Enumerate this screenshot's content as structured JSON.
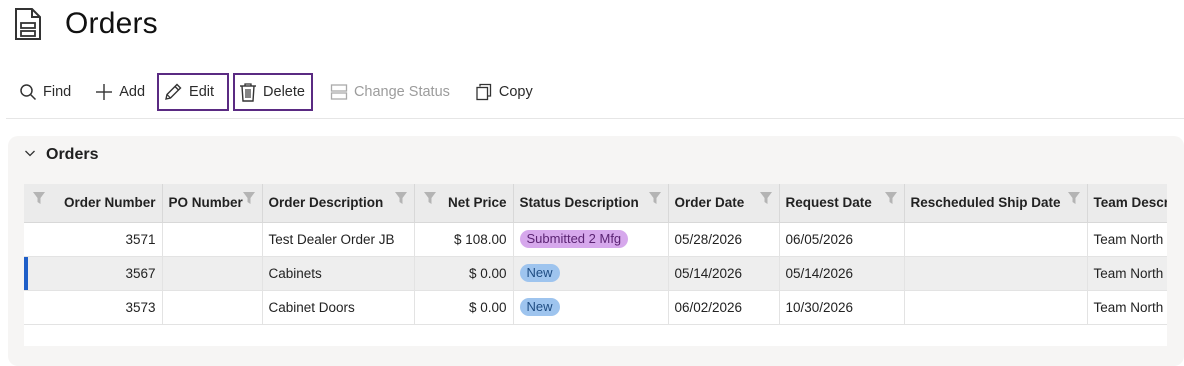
{
  "page": {
    "title": "Orders"
  },
  "toolbar": {
    "find": "Find",
    "add": "Add",
    "edit": "Edit",
    "delete": "Delete",
    "change_status": "Change Status",
    "copy": "Copy"
  },
  "panel": {
    "title": "Orders"
  },
  "grid": {
    "columns": [
      "Order Number",
      "PO Number",
      "Order Description",
      "Net Price",
      "Status Description",
      "Order Date",
      "Request Date",
      "Rescheduled Ship Date",
      "Team Description"
    ],
    "rows": [
      {
        "order_number": "3571",
        "po_number": "",
        "description": "Test Dealer Order JB",
        "net_price": "$ 108.00",
        "status": "Submitted 2 Mfg",
        "order_date": "05/28/2026",
        "request_date": "06/05/2026",
        "rescheduled": "",
        "team": "Team North"
      },
      {
        "order_number": "3567",
        "po_number": "",
        "description": "Cabinets",
        "net_price": "$ 0.00",
        "status": "New",
        "order_date": "05/14/2026",
        "request_date": "05/14/2026",
        "rescheduled": "",
        "team": "Team North"
      },
      {
        "order_number": "3573",
        "po_number": "",
        "description": "Cabinet Doors",
        "net_price": "$ 0.00",
        "status": "New",
        "order_date": "06/02/2026",
        "request_date": "10/30/2026",
        "rescheduled": "",
        "team": "Team North"
      }
    ]
  },
  "colors": {
    "outline": "#5a2a82",
    "selected_marker": "#1f5fc8",
    "badge_submitted": "#d6a8ec",
    "badge_new": "#9ec4ee"
  }
}
